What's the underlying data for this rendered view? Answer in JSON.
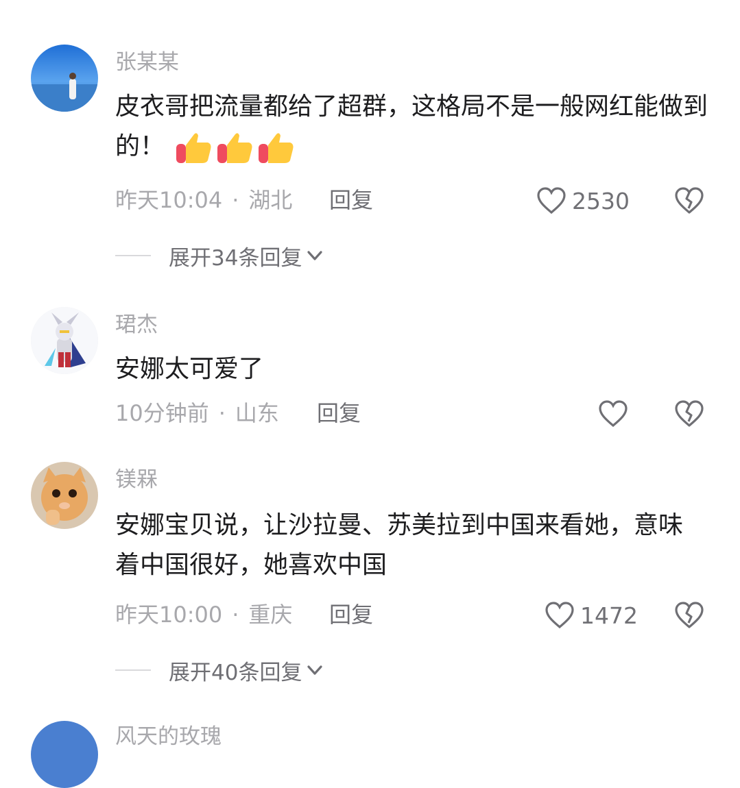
{
  "comments": [
    {
      "username": "张某某",
      "text": "皮衣哥把流量都给了超群，这格局不是一般网红能做到的！",
      "emoji": [
        "thumbs-up-emoji",
        "thumbs-up-emoji",
        "thumbs-up-emoji"
      ],
      "time": "昨天10:04",
      "sep": "·",
      "location": "湖北",
      "reply_label": "回复",
      "likes": "2530",
      "expand_label": "展开34条回复"
    },
    {
      "username": "珺杰",
      "text": "安娜太可爱了",
      "time": "10分钟前",
      "sep": "·",
      "location": "山东",
      "reply_label": "回复",
      "likes": ""
    },
    {
      "username": "镁槑",
      "text": "安娜宝贝说，让沙拉曼、苏美拉到中国来看她，意味着中国很好，她喜欢中国",
      "time": "昨天10:00",
      "sep": "·",
      "location": "重庆",
      "reply_label": "回复",
      "likes": "1472",
      "expand_label": "展开40条回复"
    },
    {
      "username": "风天的玫瑰"
    }
  ],
  "icons": {
    "like": "heart-outline-icon",
    "dislike": "broken-heart-icon",
    "expand": "chevron-down-icon"
  },
  "colors": {
    "username": "#a8a8ac",
    "text": "#1d1d1f",
    "meta": "#a8a8ac",
    "action": "#6f6f74"
  }
}
